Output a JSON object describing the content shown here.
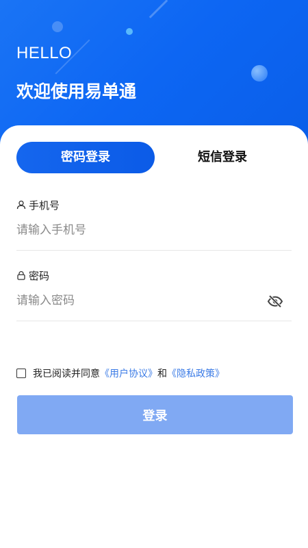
{
  "header": {
    "greeting": "HELLO",
    "welcome": "欢迎使用易单通"
  },
  "tabs": [
    {
      "label": "密码登录",
      "active": true
    },
    {
      "label": "短信登录",
      "active": false
    }
  ],
  "phone": {
    "label": "手机号",
    "placeholder": "请输入手机号",
    "icon": "user-icon"
  },
  "password": {
    "label": "密码",
    "placeholder": "请输入密码",
    "icon": "lock-icon",
    "toggle_icon": "eye-off-icon"
  },
  "agreement": {
    "checked": false,
    "prefix": "我已阅读并同意",
    "user_agreement": "《用户协议》",
    "conj": "和",
    "privacy_policy": "《隐私政策》"
  },
  "submit": {
    "label": "登录"
  },
  "colors": {
    "primary": "#0d66f3",
    "button_disabled": "#80a9f3",
    "link": "#3b7be6"
  }
}
